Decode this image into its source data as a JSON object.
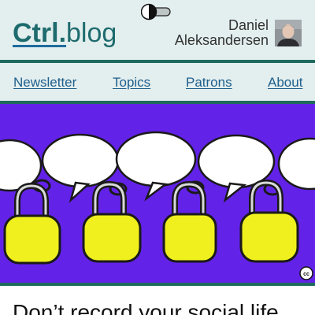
{
  "site": {
    "logo_primary": "Ctrl",
    "logo_dot": ".",
    "logo_secondary": "blog"
  },
  "author": {
    "first_name": "Daniel",
    "last_name": "Aleksandersen"
  },
  "theme_toggle": {
    "icon": "contrast-icon",
    "state": "light"
  },
  "nav": {
    "items": [
      {
        "label": "Newsletter"
      },
      {
        "label": "Topics"
      },
      {
        "label": "Patrons"
      },
      {
        "label": "About"
      }
    ]
  },
  "hero": {
    "cc_label": "cc"
  },
  "article": {
    "title": "Don’t record your social life"
  },
  "colors": {
    "accent": "#1e6b6e",
    "link": "#1e5f8c",
    "header_bg": "#e3eeee",
    "hero_bg": "#6322e8",
    "lock_yellow": "#f0f01e"
  }
}
